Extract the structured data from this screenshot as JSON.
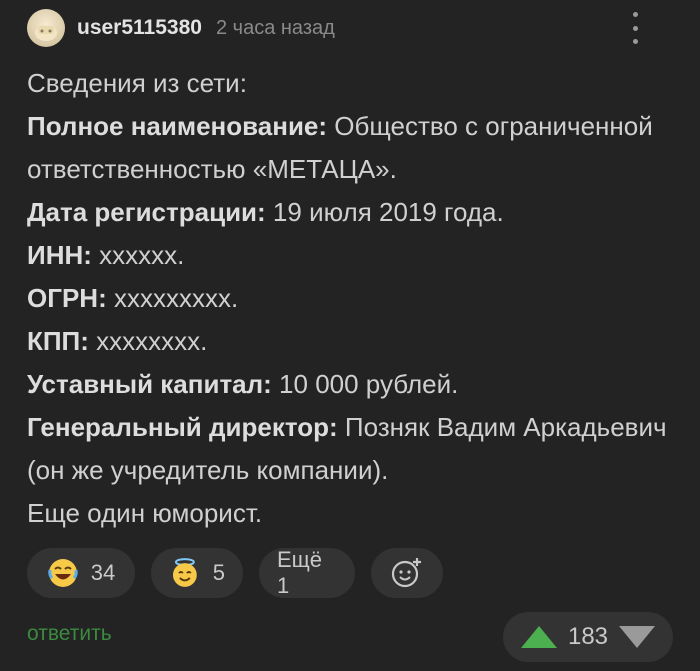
{
  "comment": {
    "username": "user5115380",
    "time": "2 часа назад",
    "intro": "Сведения из сети:",
    "fields": [
      {
        "label": "Полное наименование:",
        "value": " Общество с ограниченной ответственностью «МЕТАЦА»."
      },
      {
        "label": "Дата регистрации:",
        "value": " 19 июля 2019 года."
      },
      {
        "label": "ИНН:",
        "value": " xxxxxx."
      },
      {
        "label": "ОГРН:",
        "value": " xxxxxxxxx."
      },
      {
        "label": "КПП:",
        "value": " xxxxxxxx."
      },
      {
        "label": "Уставный капитал:",
        "value": " 10 000 рублей."
      },
      {
        "label": "Генеральный директор:",
        "value": " Позняк Вадим Аркадьевич (он же учредитель компании)."
      }
    ],
    "closing": "Еще один юморист."
  },
  "reactions": {
    "laugh_count": "34",
    "smile_count": "5",
    "more_label": "Ещё 1"
  },
  "footer": {
    "reply_label": "ответить",
    "score": "183"
  },
  "colors": {
    "background": "#232323",
    "pill": "#333333",
    "reply_green": "#3a8a3f",
    "upvote_green": "#4caf50"
  }
}
